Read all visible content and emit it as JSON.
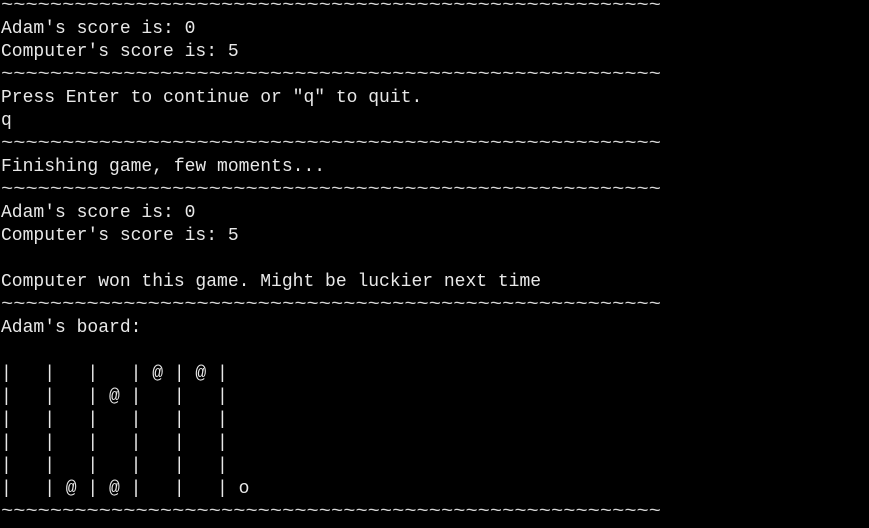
{
  "terminal": {
    "separator": "~~~~~~~~~~~~~~~~~~~~~~~~~~~~~~~~~~~~~~~~~~~~~~~~~~~~~~",
    "lines": [
      {
        "kind": "sep"
      },
      {
        "kind": "text",
        "text": "Adam's score is: 0"
      },
      {
        "kind": "text",
        "text": "Computer's score is: 5"
      },
      {
        "kind": "sep"
      },
      {
        "kind": "text",
        "text": "Press Enter to continue or \"q\" to quit."
      },
      {
        "kind": "input",
        "text": "q"
      },
      {
        "kind": "sep"
      },
      {
        "kind": "text",
        "text": "Finishing game, few moments..."
      },
      {
        "kind": "sep"
      },
      {
        "kind": "text",
        "text": "Adam's score is: 0"
      },
      {
        "kind": "text",
        "text": "Computer's score is: 5"
      },
      {
        "kind": "text",
        "text": ""
      },
      {
        "kind": "text",
        "text": "Computer won this game. Might be luckier next time"
      },
      {
        "kind": "sep"
      },
      {
        "kind": "text",
        "text": "Adam's board:"
      },
      {
        "kind": "text",
        "text": ""
      },
      {
        "kind": "board",
        "text": "|   |   |   | @ | @ |"
      },
      {
        "kind": "board",
        "text": "|   |   | @ |   |   |"
      },
      {
        "kind": "board",
        "text": "|   |   |   |   |   |"
      },
      {
        "kind": "board",
        "text": "|   |   |   |   |   |"
      },
      {
        "kind": "board",
        "text": "|   |   |   |   |   |"
      },
      {
        "kind": "board",
        "text": "|   | @ | @ |   |   | o"
      },
      {
        "kind": "sep"
      }
    ]
  }
}
